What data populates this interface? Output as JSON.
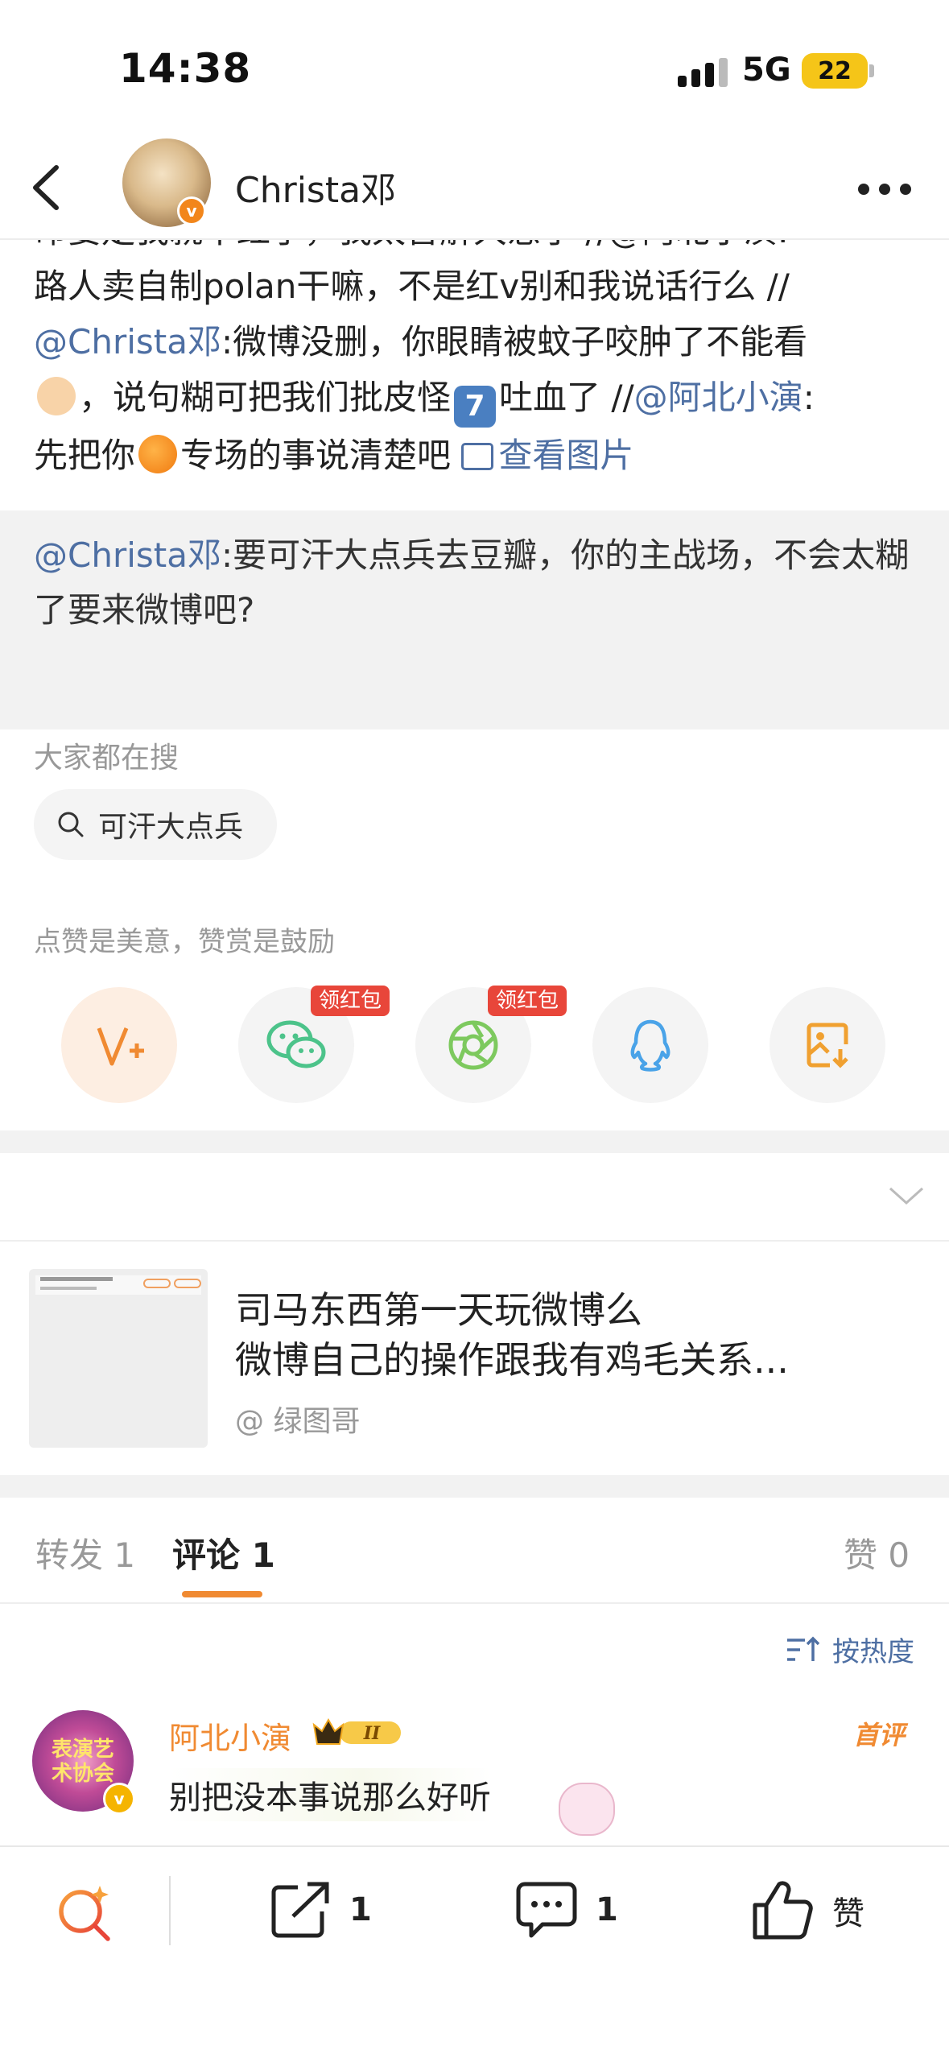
{
  "status": {
    "time": "14:38",
    "network": "5G",
    "battery": "22"
  },
  "header": {
    "name": "Christa邓",
    "verified_mark": "v"
  },
  "post": {
    "line1_partial": "命要走我就不红了，我太害解大患了 //@阿北小演:",
    "line2": "路人卖自制polan干嘛，不是红v别和我说话行么 //",
    "mention_christa": "@Christa邓",
    "line3_rest": ":微博没删，你眼睛被蚊子咬肿了不能看",
    "line4_a": "，说句糊可把我们批皮怪",
    "keycap": "7",
    "line4_b": "吐血了 //",
    "mention_abei": "@阿北小演",
    "colon": ":",
    "line5_a": "先把你",
    "line5_b": "专场的事说清楚吧",
    "view_image": "查看图片"
  },
  "quote": {
    "mention": "@Christa邓",
    "text": ":要可汗大点兵去豆瓣，你的主战场，不会太糊了要来微博吧?"
  },
  "search": {
    "title": "大家都在搜",
    "chip": "可汗大点兵"
  },
  "reward": {
    "title": "点赞是美意，赞赏是鼓励",
    "redpack_label": "领红包",
    "buttons": [
      "reward-v-icon",
      "wechat-icon",
      "moments-icon",
      "qq-icon",
      "save-image-icon"
    ]
  },
  "linked_card": {
    "title_line1": "司马东西第一天玩微博么",
    "title_line2": "微博自己的操作跟我有鸡毛关系...",
    "author": "@ 绿图哥"
  },
  "tabs": {
    "repost": "转发 1",
    "comment": "评论 1",
    "like": "赞 0"
  },
  "sort": {
    "label": "按热度"
  },
  "comment": {
    "avatar_label": "表演艺术协会",
    "name": "阿北小演",
    "vip_level": "II",
    "text": "别把没本事说那么好听",
    "first_badge": "首评"
  },
  "bottom_bar": {
    "repost_count": "1",
    "comment_count": "1",
    "like_label": "赞"
  },
  "colors": {
    "accent_orange": "#f08a32",
    "link_blue": "#4e6fa3",
    "redpack": "#e8463a",
    "battery": "#f5c518"
  }
}
